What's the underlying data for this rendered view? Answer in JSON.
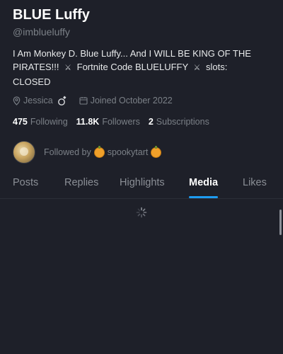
{
  "profile": {
    "display_name": "BLUE Luffy",
    "handle": "@imblueluffy",
    "bio_part1": "I Am Monkey D. Blue Luffy... And I WILL BE KING OF THE PIRATES!!!",
    "bio_part2": "Fortnite Code BLUELUFFY",
    "bio_part3": "slots: CLOSED",
    "swords_glyph": "⚔",
    "location": "Jessica",
    "joined": "Joined October 2022"
  },
  "stats": {
    "following_count": "475",
    "following_label": "Following",
    "followers_count": "11.8K",
    "followers_label": "Followers",
    "subscriptions_count": "2",
    "subscriptions_label": "Subscriptions"
  },
  "followed_by": {
    "prefix": "Followed by",
    "name": "spookytart"
  },
  "tabs": [
    {
      "label": "Posts",
      "active": false
    },
    {
      "label": "Replies",
      "active": false
    },
    {
      "label": "Highlights",
      "active": false
    },
    {
      "label": "Media",
      "active": true
    },
    {
      "label": "Likes",
      "active": false
    }
  ],
  "colors": {
    "background": "#1e2029",
    "accent": "#1d9bf0",
    "muted_text": "#7b8087",
    "primary_text": "#e7e9ea"
  },
  "icons": {
    "location": "location-pin-icon",
    "ring": "ring-icon",
    "calendar": "calendar-icon",
    "loading": "loading-spinner-icon"
  }
}
